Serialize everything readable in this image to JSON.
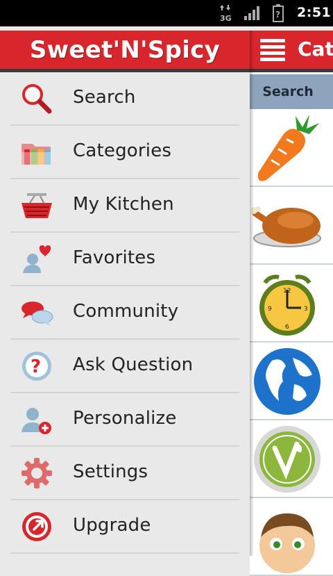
{
  "status_bar": {
    "network": "3G",
    "time": "2:51"
  },
  "app": {
    "title": "Sweet'N'Spicy",
    "brand_color": "#d8262c"
  },
  "drawer": {
    "items": [
      {
        "label": "Search",
        "icon": "magnifier-icon"
      },
      {
        "label": "Categories",
        "icon": "folders-icon"
      },
      {
        "label": "My Kitchen",
        "icon": "basket-icon"
      },
      {
        "label": "Favorites",
        "icon": "user-heart-icon"
      },
      {
        "label": "Community",
        "icon": "chat-bubbles-icon"
      },
      {
        "label": "Ask Question",
        "icon": "question-icon"
      },
      {
        "label": "Personalize",
        "icon": "user-add-icon"
      },
      {
        "label": "Settings",
        "icon": "gear-icon"
      },
      {
        "label": "Upgrade",
        "icon": "upgrade-icon"
      }
    ]
  },
  "content": {
    "title": "Cate",
    "search_tab": "Search",
    "thumbnails": [
      "carrot-icon",
      "roast-chicken-icon",
      "alarm-clock-icon",
      "globe-icon",
      "vegan-badge-icon",
      "baby-face-icon"
    ]
  }
}
